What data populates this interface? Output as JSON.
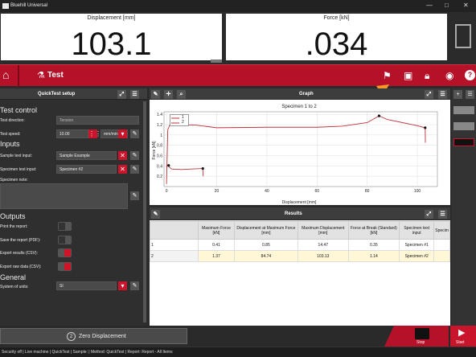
{
  "app": {
    "title": "Bluehill Universal",
    "min": "—",
    "max": "□",
    "close": "✕"
  },
  "meters": [
    {
      "label": "Displacement [mm]",
      "value": "103.1"
    },
    {
      "label": "Force [kN]",
      "value": ".034"
    }
  ],
  "nav": {
    "title": "Test"
  },
  "setup": {
    "title": "QuickTest setup",
    "test_control": "Test control",
    "test_direction_label": "Test direction:",
    "test_direction_value": "Tension",
    "test_speed_label": "Test speed:",
    "test_speed_value": "10.00",
    "test_speed_unit": "mm/min",
    "inputs": "Inputs",
    "sample_label": "Sample text input:",
    "sample_value": "Sample Example",
    "specimen_label": "Specimen text input:",
    "specimen_value": "Specimen #2",
    "note_label": "Specimen note:",
    "outputs": "Outputs",
    "print_label": "Print the report:",
    "save_label": "Save the report (PDF):",
    "export_results_label": "Export results (CSV):",
    "export_raw_label": "Export raw data (CSV):",
    "general": "General",
    "units_label": "System of units:",
    "units_value": "SI"
  },
  "graph": {
    "title": "Graph",
    "chart_title": "Specimen 1 to 2",
    "xlabel": "Displacement [mm]",
    "ylabel": "Force [kN]",
    "legend": [
      "1",
      "2"
    ]
  },
  "chart_data": {
    "type": "line",
    "title": "Specimen 1 to 2",
    "xlabel": "Displacement [mm]",
    "ylabel": "Force [kN]",
    "xlim": [
      -1,
      108
    ],
    "ylim": [
      0,
      1.45
    ],
    "xticks": [
      0,
      20,
      40,
      60,
      80,
      100
    ],
    "yticks": [
      0.2,
      0.4,
      0.6,
      0.8,
      1,
      1.2,
      1.4
    ],
    "series": [
      {
        "name": "1",
        "color": "#c0303a",
        "points": [
          [
            0,
            0.38
          ],
          [
            0.3,
            0.41
          ],
          [
            2,
            0.34
          ],
          [
            6,
            0.33
          ],
          [
            10,
            0.34
          ],
          [
            14.47,
            0.35
          ],
          [
            14.6,
            0.2
          ]
        ]
      },
      {
        "name": "2",
        "color": "#c0303a",
        "points": [
          [
            0,
            0.05
          ],
          [
            0.5,
            1.1
          ],
          [
            2,
            1.28
          ],
          [
            6,
            1.2
          ],
          [
            12,
            1.19
          ],
          [
            20,
            1.14
          ],
          [
            40,
            1.15
          ],
          [
            60,
            1.15
          ],
          [
            70,
            1.17
          ],
          [
            80,
            1.24
          ],
          [
            84.74,
            1.37
          ],
          [
            88,
            1.3
          ],
          [
            100,
            1.18
          ],
          [
            103.13,
            1.14
          ],
          [
            103.2,
            0.85
          ]
        ]
      }
    ]
  },
  "results": {
    "title": "Results",
    "headers": [
      "",
      "Maximum Force [kN]",
      "Displacement at Maximum Force [mm]",
      "Maximum Displacement [mm]",
      "Force at Break (Standard) [kN]",
      "Specimen text input",
      "Specim"
    ],
    "rows": [
      [
        "1",
        "0.41",
        "0.85",
        "14.47",
        "0.35",
        "Specimen #1",
        ""
      ],
      [
        "2",
        "1.37",
        "84.74",
        "103.13",
        "1.14",
        "Specimen #2",
        ""
      ]
    ]
  },
  "actions": {
    "zero": "Zero Displacement",
    "zero_num": "2",
    "stop": "Stop",
    "start": "Start"
  },
  "status": "Security off | Live machine | QuickTest | Sample: | Method: QuickTest | Report: Report - All Items"
}
